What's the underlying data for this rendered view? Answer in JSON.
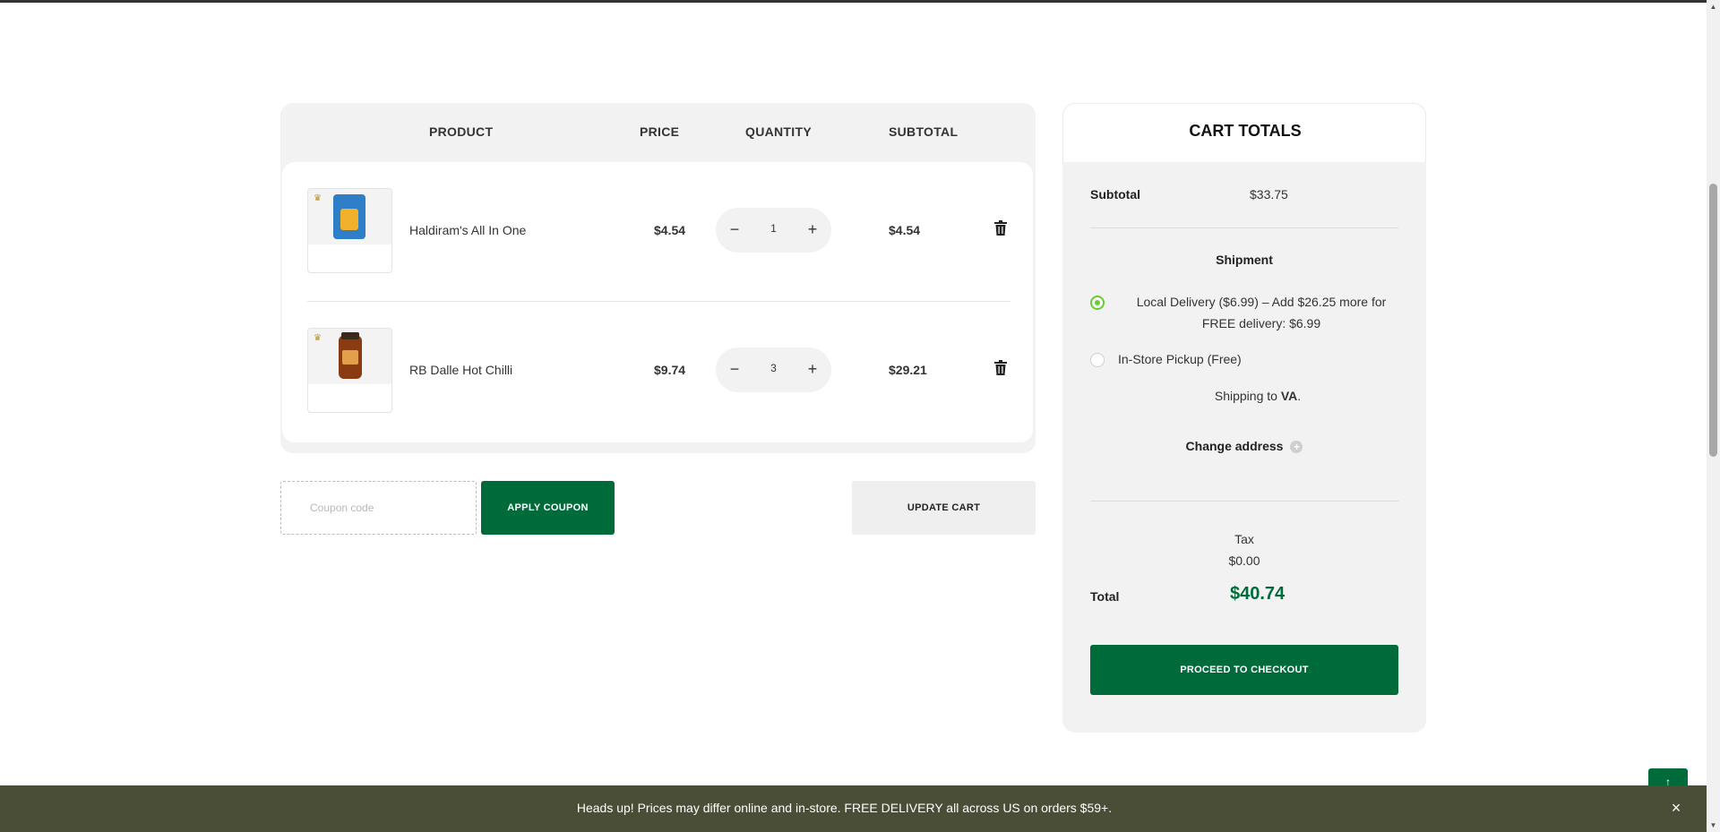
{
  "cart": {
    "headers": {
      "product": "PRODUCT",
      "price": "PRICE",
      "quantity": "QUANTITY",
      "subtotal": "SUBTOTAL"
    },
    "items": [
      {
        "name": "Haldiram's All In One",
        "price": "$4.54",
        "quantity": "1",
        "subtotal": "$4.54"
      },
      {
        "name": "RB Dalle Hot Chilli",
        "price": "$9.74",
        "quantity": "3",
        "subtotal": "$29.21"
      }
    ]
  },
  "coupon": {
    "placeholder": "Coupon code",
    "apply_label": "APPLY COUPON"
  },
  "update_label": "UPDATE CART",
  "totals": {
    "title": "CART TOTALS",
    "subtotal_label": "Subtotal",
    "subtotal_value": "$33.75",
    "shipment_label": "Shipment",
    "options": [
      {
        "line1": "Local Delivery ($6.99) – Add $26.25 more for",
        "line2": "FREE delivery: $6.99",
        "selected": true
      },
      {
        "line1": "In-Store Pickup (Free)",
        "selected": false
      }
    ],
    "shipping_to_prefix": "Shipping to ",
    "shipping_to_state": "VA",
    "shipping_to_suffix": ".",
    "change_address": "Change address",
    "tax_label": "Tax",
    "tax_value": "$0.00",
    "total_label": "Total",
    "total_value": "$40.74",
    "checkout_label": "PROCEED TO CHECKOUT"
  },
  "notice": {
    "text": "Heads up! Prices may differ online and in-store. FREE DELIVERY all across US on orders $59+.",
    "close_icon": "×"
  },
  "colors": {
    "brand_green": "#006b3a",
    "radio_green": "#66cc33",
    "notice_bg": "#4a4e37"
  }
}
